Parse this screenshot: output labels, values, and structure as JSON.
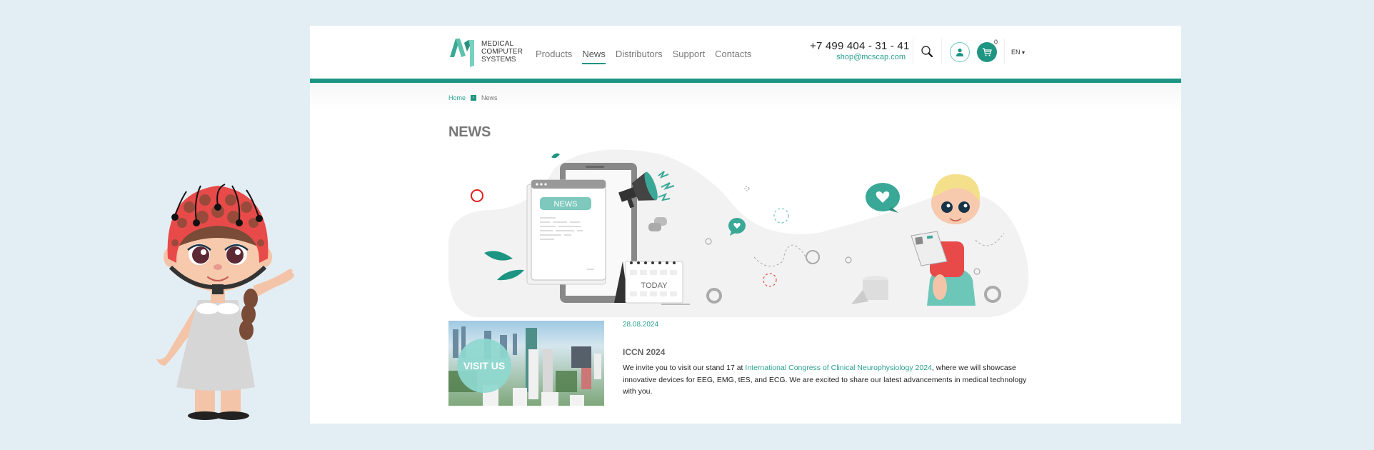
{
  "header": {
    "logo": {
      "lines": [
        "MEDICAL",
        "COMPUTER",
        "SYSTEMS"
      ]
    },
    "nav": [
      {
        "label": "Products",
        "active": false
      },
      {
        "label": "News",
        "active": true
      },
      {
        "label": "Distributors",
        "active": false
      },
      {
        "label": "Support",
        "active": false
      },
      {
        "label": "Contacts",
        "active": false
      }
    ],
    "phone": "+7 499 404 - 31 - 41",
    "email": "shop@mcscap.com",
    "icons": {
      "search": "search-icon",
      "user": "user-icon",
      "cart": "cart-icon"
    },
    "cart_count": "0",
    "language": "EN"
  },
  "breadcrumb": {
    "home": "Home",
    "separator_icon": "chevron-right-icon",
    "current": "News"
  },
  "page_title": "NEWS",
  "hero": {
    "news_card_label": "NEWS",
    "calendar_label": "TODAY"
  },
  "news": [
    {
      "thumbnail_label": "VISIT US",
      "date": "28.08.2024",
      "title": "ICCN 2024",
      "body_before_link": "We invite you to visit our stand 17 at ",
      "link_text": "International Congress of Clinical Neurophysiology 2024",
      "body_after_link": ", where we will showcase innovative devices for EEG, EMG, tES, and ECG. We are excited to share our latest advancements in medical technology with you."
    }
  ],
  "colors": {
    "brand_teal": "#1e9582",
    "link_teal": "#2aa190",
    "page_background": "#e3eef4"
  }
}
